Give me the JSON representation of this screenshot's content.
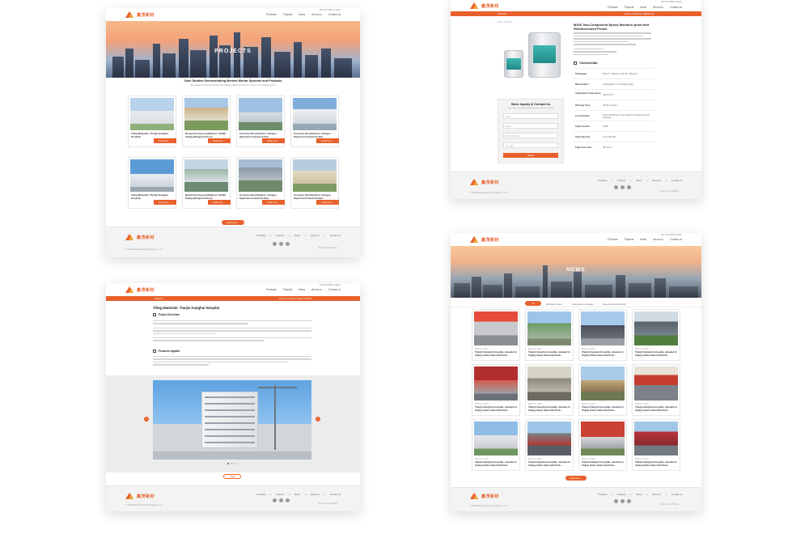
{
  "brand": {
    "logo_text": "鑫茂新材",
    "footer_copy": "© 2024 Merinet Mortar Technology Co., Ltd."
  },
  "nav": {
    "items": [
      "Products",
      "Projects",
      "News",
      "About us",
      "Contact us"
    ],
    "phone": "400-878-4588",
    "lang": "English"
  },
  "colors": {
    "accent": "#e8612c"
  },
  "footer": {
    "links": [
      "Products",
      "Projects",
      "News",
      "About us",
      "Contact us"
    ],
    "terms": "Terms of use  |  Privacy"
  },
  "projects_page": {
    "hero_title": "PROJECTS",
    "heading": "Case Studies Demonstrating Merinet Mortar Systems and Products",
    "subheading": "We provide professional solutions and reliable products to deliver in a variety of construction needs",
    "cards": [
      {
        "caption": "Tiling Materials: Tianjin Kanghui Hospital",
        "button": "Read more"
      },
      {
        "caption": "Breda Flooring Installations: BCNU Xiqing Bilingual School",
        "button": "Read more"
      },
      {
        "caption": "Concrete Densification: Jiangsu High-Tech Industrial Park",
        "button": "Read more"
      },
      {
        "caption": "Concrete Densification: Jiangsu High-Tech Industrial Park",
        "button": "Read more"
      },
      {
        "caption": "Tiling Materials: Tianjin Kanghui Hospital",
        "button": "Read more"
      },
      {
        "caption": "Breda Flooring Installations: BCNU Xiqing Bilingual School",
        "button": "Read more"
      },
      {
        "caption": "Concrete Densification: Jiangsu High-Tech Industrial Park",
        "button": "Read more"
      },
      {
        "caption": "Concrete Densification: Jiangsu High-Tech Industrial Park",
        "button": "Read more"
      }
    ],
    "load_more": "Load more"
  },
  "product_page": {
    "bar_left": "Products",
    "bar_right": "Home / Products / Waterproof",
    "breadcrumb": "Home / Products",
    "title": "M100 Two-Component Epoxy Moisture-proof and Reinforcement Primer",
    "inquiry_title": "Sales Inquiry & Contact Us",
    "inquiry_sub": "If you have any product-related questions, please click here",
    "fields": [
      "Name*",
      "Email*",
      "Phone Number",
      "Message"
    ],
    "submit": "Submit",
    "tech_title": "Technical Data",
    "specs": [
      {
        "label": "Packaging",
        "value": "Part A: 4.5kg/set, Part B: 1.5kg/set"
      },
      {
        "label": "Mixing Ratio",
        "value": "A:B(weight) = 3:1(4.5kg:1.5kg)"
      },
      {
        "label": "Applicable Temperature",
        "value": "Above 5°C"
      },
      {
        "label": "Working Time",
        "value": "30-60 minutes"
      },
      {
        "label": "Consumption",
        "value": "About 150-300 g/m² (when applied to standard cement substrate)"
      },
      {
        "label": "Solid Content",
        "value": "100%"
      },
      {
        "label": "Substrate Dry",
        "value": "Up to 8% MC"
      },
      {
        "label": "Fully Cure After",
        "value": "48 hours"
      }
    ]
  },
  "case_page": {
    "bar_left": "Projects",
    "bar_right": "Home / Projects / Project Details",
    "title": "Tiling Materials: Tianjin Kanghui Hospital",
    "overview_title": "Project Overview",
    "applied_title": "Products Applied",
    "back": "< Back"
  },
  "news_page": {
    "hero_title": "NEWS",
    "tabs": [
      "All",
      "Exhibition news",
      "Corporation message",
      "New product promotion"
    ],
    "cards": [
      {
        "date": "March 21, 2024",
        "caption": "Tianjin Kanghui Hospital, situated in Xiqing Sanle Industrial Park..."
      },
      {
        "date": "March 21, 2024",
        "caption": "Tianjin Kanghui Hospital, situated in Xiqing Sanle Industrial Park..."
      },
      {
        "date": "March 21, 2024",
        "caption": "Tianjin Kanghui Hospital, situated in Xiqing Sanle Industrial Park..."
      },
      {
        "date": "March 21, 2024",
        "caption": "Tianjin Kanghui Hospital, situated in Xiqing Sanle Industrial Park..."
      },
      {
        "date": "March 21, 2024",
        "caption": "Tianjin Kanghui Hospital, situated in Xiqing Sanle Industrial Park..."
      },
      {
        "date": "March 21, 2024",
        "caption": "Tianjin Kanghui Hospital, situated in Xiqing Sanle Industrial Park..."
      },
      {
        "date": "March 21, 2024",
        "caption": "Tianjin Kanghui Hospital, situated in Xiqing Sanle Industrial Park..."
      },
      {
        "date": "March 21, 2024",
        "caption": "Tianjin Kanghui Hospital, situated in Xiqing Sanle Industrial Park..."
      },
      {
        "date": "March 21, 2024",
        "caption": "Tianjin Kanghui Hospital, situated in Xiqing Sanle Industrial Park..."
      },
      {
        "date": "March 21, 2024",
        "caption": "Tianjin Kanghui Hospital, situated in Xiqing Sanle Industrial Park..."
      },
      {
        "date": "March 21, 2024",
        "caption": "Tianjin Kanghui Hospital, situated in Xiqing Sanle Industrial Park..."
      },
      {
        "date": "March 21, 2024",
        "caption": "Tianjin Kanghui Hospital, situated in Xiqing Sanle Industrial Park..."
      }
    ],
    "load_more": "Load more"
  }
}
